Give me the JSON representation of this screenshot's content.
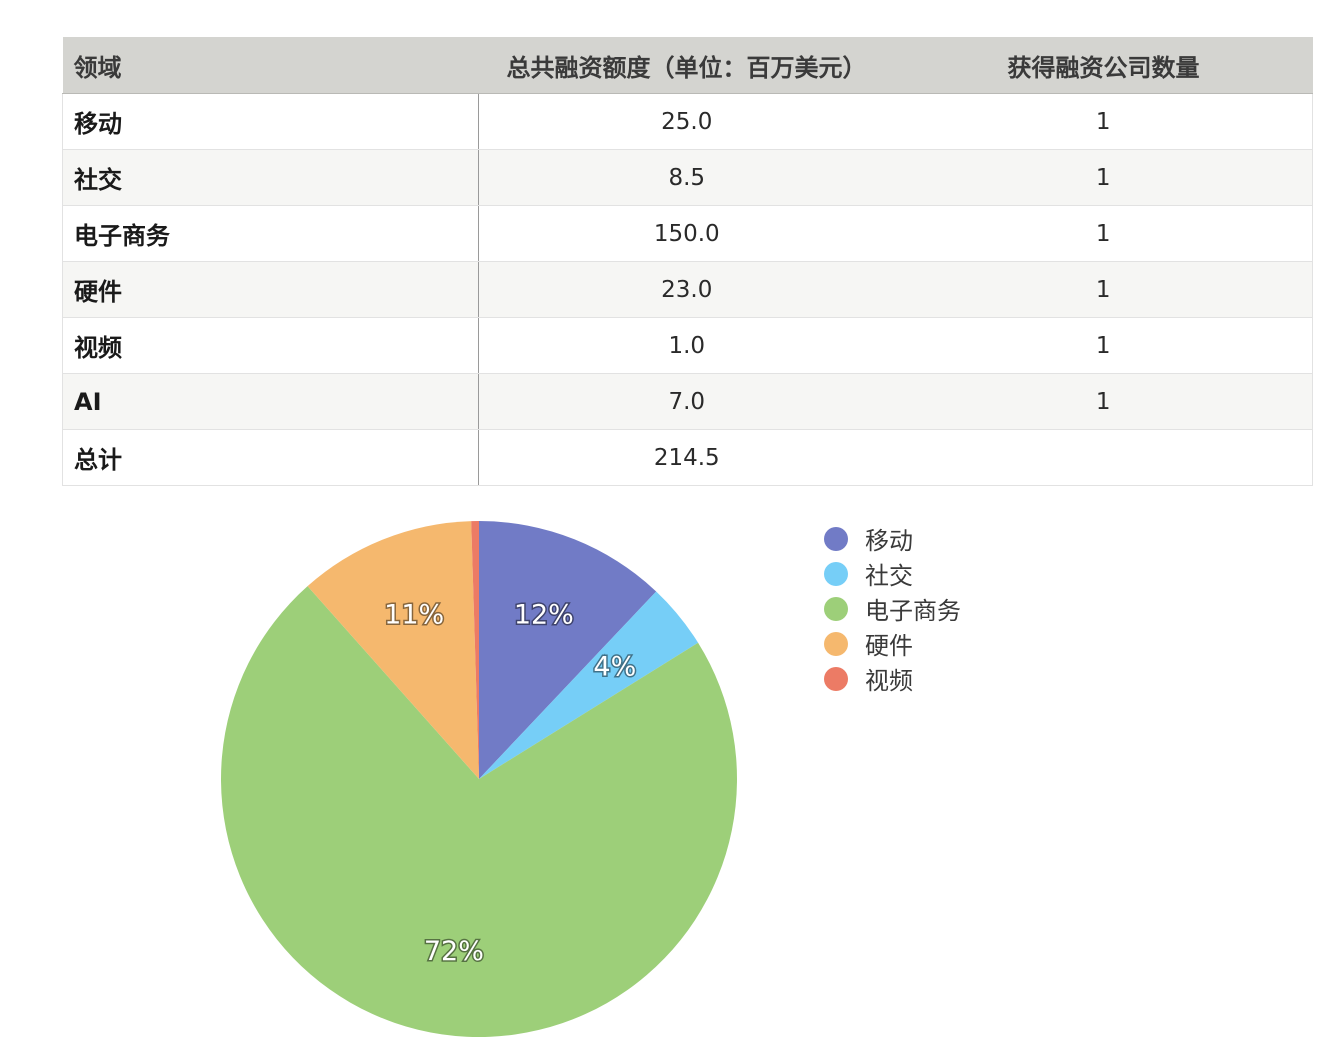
{
  "table": {
    "headers": [
      "领域",
      "总共融资额度（单位：百万美元）",
      "获得融资公司数量"
    ],
    "rows": [
      {
        "field": "移动",
        "amount": "25.0",
        "count": "1"
      },
      {
        "field": "社交",
        "amount": "8.5",
        "count": "1"
      },
      {
        "field": "电子商务",
        "amount": "150.0",
        "count": "1"
      },
      {
        "field": "硬件",
        "amount": "23.0",
        "count": "1"
      },
      {
        "field": "视频",
        "amount": "1.0",
        "count": "1"
      },
      {
        "field": "AI",
        "amount": "7.0",
        "count": "1"
      },
      {
        "field": "总计",
        "amount": "214.5",
        "count": ""
      }
    ]
  },
  "chart_data": {
    "type": "pie",
    "categories": [
      "移动",
      "社交",
      "电子商务",
      "硬件",
      "视频"
    ],
    "values": [
      25.0,
      8.5,
      150.0,
      23.0,
      1.0
    ],
    "percent_labels": [
      "12%",
      "4%",
      "72%",
      "11%",
      ""
    ],
    "colors": [
      "#717bc6",
      "#76cef7",
      "#9dcf79",
      "#f5b86e",
      "#ec7b65"
    ],
    "legend_position": "right"
  }
}
